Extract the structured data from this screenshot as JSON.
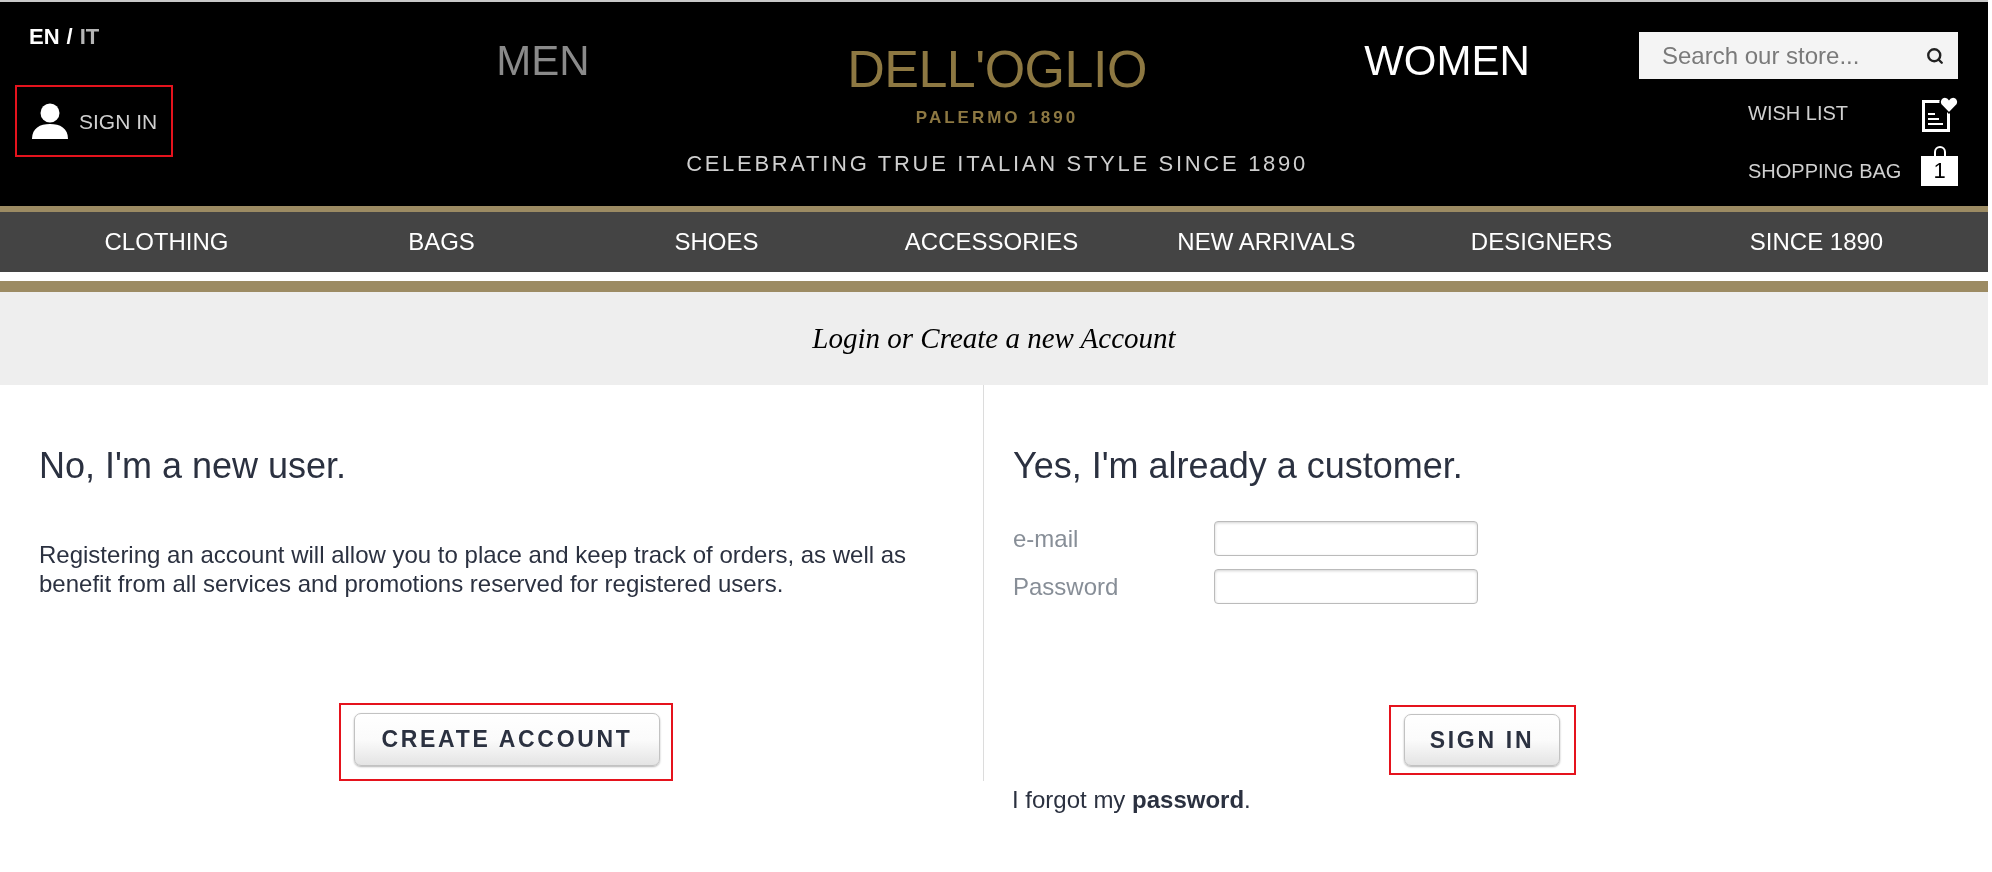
{
  "header": {
    "languages": [
      {
        "label": "EN",
        "selected": true
      },
      {
        "label": "IT",
        "selected": false
      }
    ],
    "language_separator": "/",
    "sign_in": {
      "label": "SIGN IN",
      "highlighted": true
    },
    "men_link": "MEN",
    "logo": {
      "name": "DELL'OGLIO",
      "subtitle": "PALERMO 1890"
    },
    "tagline": "CELEBRATING TRUE ITALIAN STYLE SINCE 1890",
    "women_link": "WOMEN",
    "search": {
      "placeholder": "Search our store..."
    },
    "wish_list": {
      "label": "WISH LIST"
    },
    "shopping_bag": {
      "label": "SHOPPING BAG",
      "count": "1"
    }
  },
  "nav": {
    "items": [
      "CLOTHING",
      "BAGS",
      "SHOES",
      "ACCESSORIES",
      "NEW ARRIVALS",
      "DESIGNERS",
      "SINCE 1890"
    ]
  },
  "page_title": "Login or Create a new Account",
  "new_user": {
    "heading": "No, I'm a new user.",
    "text": "Registering an account will allow you to place and keep track of orders, as well as benefit from all services and promotions reserved for registered users.",
    "button": {
      "label": "CREATE ACCOUNT",
      "highlighted": true
    }
  },
  "existing_customer": {
    "heading": "Yes, I'm already a customer.",
    "fields": [
      {
        "label": "e-mail"
      },
      {
        "label": "Password"
      }
    ],
    "button": {
      "label": "SIGN IN",
      "highlighted": true
    },
    "forgot": {
      "prefix": "I forgot my",
      "link": "password",
      "suffix": "."
    }
  }
}
